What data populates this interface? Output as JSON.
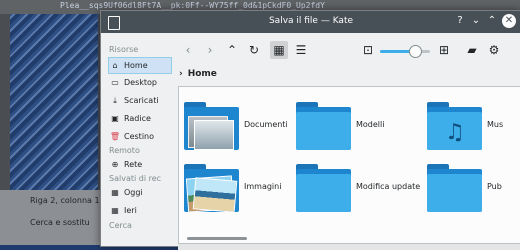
{
  "background_window": {
    "code_line": "Plea__sqs9Uf06dl8Ft7A__pk:0Ff--WY75ff_0d&1pCkdF0_Up2fdY",
    "status_position": "Riga 2, colonna 1",
    "status_search": "Cerca e sostitu"
  },
  "dialog": {
    "title": "Salva il file — Kate",
    "title_buttons": {
      "help": "?",
      "minimize": "⌄",
      "maximize": "⌃",
      "close": "✕"
    }
  },
  "sidebar": {
    "sections": [
      {
        "label": "Risorse"
      },
      {
        "label": "Remoto"
      },
      {
        "label": "Salvati di rec"
      },
      {
        "label": "Cerca"
      }
    ],
    "items": [
      {
        "label": "Home",
        "icon": "⌂",
        "active": true
      },
      {
        "label": "Desktop",
        "icon": "▭",
        "active": false
      },
      {
        "label": "Scaricati",
        "icon": "⤓",
        "active": false
      },
      {
        "label": "Radice",
        "icon": "▣",
        "active": false
      },
      {
        "label": "Cestino",
        "icon": "🗑",
        "active": false
      },
      {
        "label": "Rete",
        "icon": "⊕",
        "active": false
      },
      {
        "label": "Oggi",
        "icon": "▦",
        "active": false
      },
      {
        "label": "Ieri",
        "icon": "▦",
        "active": false
      }
    ]
  },
  "toolbar": {
    "back_icon": "‹",
    "forward_icon": "›",
    "up_icon": "⌃",
    "reload_icon": "↻",
    "icons_view_icon": "▦",
    "detail_view_icon": "☰",
    "zoom_out_icon": "⊡",
    "zoom_in_icon": "⊞",
    "new_folder_icon": "▰",
    "options_icon": "⚙",
    "zoom_level_fraction": 0.7
  },
  "breadcrumb": {
    "arrow": "›",
    "label": "Home"
  },
  "files": [
    {
      "name": "Documenti",
      "kind": "docs"
    },
    {
      "name": "Modelli",
      "kind": "plain"
    },
    {
      "name": "Mus",
      "kind": "music"
    },
    {
      "name": "Immagini",
      "kind": "images"
    },
    {
      "name": "Modifica update",
      "kind": "plain"
    },
    {
      "name": "Pub",
      "kind": "plain"
    }
  ],
  "colors": {
    "accent": "#3daee9",
    "titlebar": "#475057",
    "folder_front": "#3daee9",
    "folder_back": "#1d86cf"
  }
}
